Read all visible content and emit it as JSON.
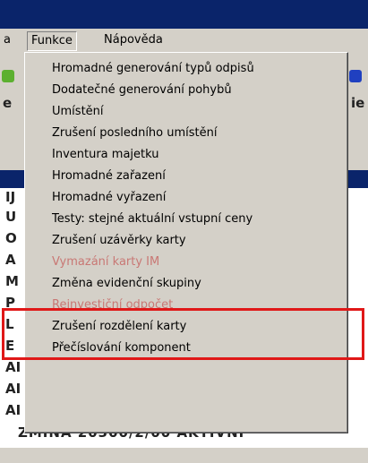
{
  "menubar": {
    "prev_item_fragment": "a",
    "functions_label": "Funkce",
    "help_label": "Nápověda"
  },
  "menu": {
    "items": [
      {
        "label": "Hromadné generování typů odpisů"
      },
      {
        "label": "Dodatečné generování pohybů"
      },
      {
        "label": "Umístění"
      },
      {
        "label": "Zrušení posledního umístění"
      },
      {
        "label": "Inventura majetku"
      },
      {
        "label": "Hromadné zařazení"
      },
      {
        "label": "Hromadné vyřazení"
      },
      {
        "label": "Testy: stejné aktuální vstupní ceny"
      },
      {
        "label": "Zrušení uzávěrky karty"
      },
      {
        "label": "Vymazání karty IM"
      },
      {
        "label": "Změna evidenční skupiny"
      },
      {
        "label": "Reinvestiční odpočet"
      },
      {
        "label": "Zrušení rozdělení karty"
      },
      {
        "label": "Přečíslování komponent"
      }
    ]
  },
  "background": {
    "left_column_letters": [
      "e",
      "IJ",
      "U",
      "O",
      "A",
      "M",
      "P",
      "L",
      "E",
      "AI",
      "AI",
      "AI"
    ],
    "right_fragment": "je",
    "bottom_row_text": "ZMINA        20300/2/00 AKTIVNI"
  },
  "colors": {
    "titlebar": "#0a246a",
    "highlight_box": "#e01818",
    "menu_bg": "#d4d0c8"
  },
  "icons": [
    "toolbar-icon-green",
    "toolbar-icon-blue"
  ]
}
